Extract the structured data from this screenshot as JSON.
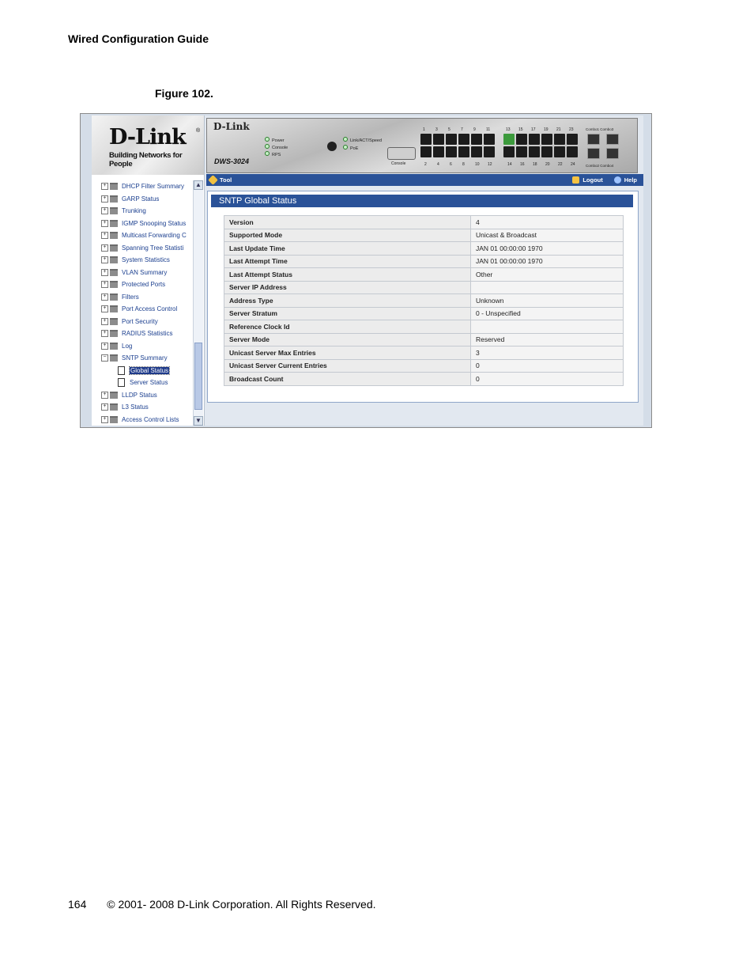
{
  "document": {
    "header": "Wired Configuration Guide",
    "figure_caption": "Figure 102.",
    "footer": {
      "page_number": "164",
      "copyright": "© 2001- 2008 D-Link Corporation. All Rights Reserved."
    }
  },
  "sidebar": {
    "logo": {
      "name": "D-Link",
      "registered": "®",
      "tagline": "Building Networks for People"
    },
    "tree": [
      {
        "label": "DHCP Filter Summary"
      },
      {
        "label": "GARP Status"
      },
      {
        "label": "Trunking"
      },
      {
        "label": "IGMP Snooping Status"
      },
      {
        "label": "Multicast Forwarding C"
      },
      {
        "label": "Spanning Tree Statisti"
      },
      {
        "label": "System Statistics"
      },
      {
        "label": "VLAN Summary"
      },
      {
        "label": "Protected Ports"
      },
      {
        "label": "Filters"
      },
      {
        "label": "Port Access Control"
      },
      {
        "label": "Port Security"
      },
      {
        "label": "RADIUS Statistics"
      },
      {
        "label": "Log"
      },
      {
        "label": "SNTP Summary"
      },
      {
        "label": "Global Status"
      },
      {
        "label": "Server Status"
      },
      {
        "label": "LLDP Status"
      },
      {
        "label": "L3 Status"
      },
      {
        "label": "Access Control Lists"
      }
    ],
    "scroll_up_icon": "chevron-up-icon",
    "scroll_down_icon": "chevron-down-icon"
  },
  "device": {
    "brand": "D-Link",
    "model": "DWS-3024",
    "leds": [
      "Power",
      "Console",
      "RPS"
    ],
    "leds_right": [
      "Link/ACT/Speed",
      "PoE"
    ],
    "console_label": "Console",
    "ports_top": [
      "1",
      "3",
      "5",
      "7",
      "9",
      "11",
      "13",
      "15",
      "17",
      "19",
      "21",
      "23"
    ],
    "ports_bottom": [
      "2",
      "4",
      "6",
      "8",
      "10",
      "12",
      "14",
      "16",
      "18",
      "20",
      "22",
      "24"
    ],
    "combo_top": "Combo1 Combo3",
    "combo_bottom": "Combo2 Combo4"
  },
  "toolbar": {
    "tool": "Tool",
    "logout": "Logout",
    "help": "Help"
  },
  "panel": {
    "title": "SNTP Global Status",
    "rows": [
      {
        "label": "Version",
        "value": "4"
      },
      {
        "label": "Supported Mode",
        "value": "Unicast & Broadcast"
      },
      {
        "label": "Last Update Time",
        "value": "JAN 01 00:00:00 1970"
      },
      {
        "label": "Last Attempt Time",
        "value": "JAN 01 00:00:00 1970"
      },
      {
        "label": "Last Attempt Status",
        "value": "Other"
      },
      {
        "label": "Server IP Address",
        "value": ""
      },
      {
        "label": "Address Type",
        "value": "Unknown"
      },
      {
        "label": "Server Stratum",
        "value": "0 - Unspecified"
      },
      {
        "label": "Reference Clock Id",
        "value": ""
      },
      {
        "label": "Server Mode",
        "value": "Reserved"
      },
      {
        "label": "Unicast Server Max Entries",
        "value": "3"
      },
      {
        "label": "Unicast Server Current Entries",
        "value": "0"
      },
      {
        "label": "Broadcast Count",
        "value": "0"
      }
    ]
  }
}
